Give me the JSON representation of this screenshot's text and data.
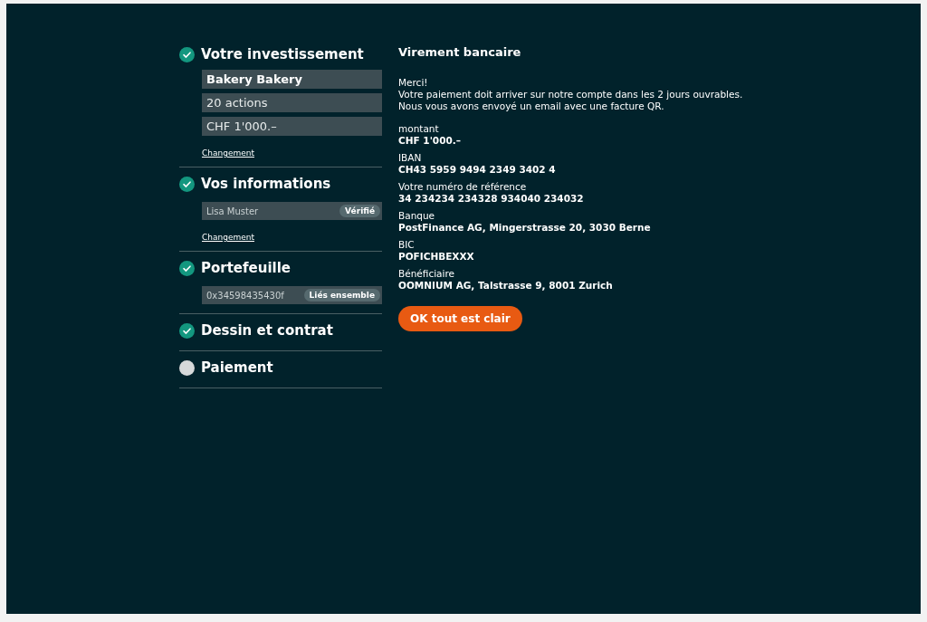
{
  "steps": [
    {
      "title": "Votre investissement",
      "completed": true,
      "fields": [
        {
          "kind": "heading",
          "value": "Bakery Bakery"
        },
        {
          "kind": "plain",
          "value": "20 actions"
        },
        {
          "kind": "plain",
          "value": "CHF 1'000.–"
        }
      ],
      "link": "Changement"
    },
    {
      "title": "Vos informations",
      "completed": true,
      "fields": [
        {
          "kind": "compact",
          "value": "Lisa Muster",
          "badge": "Vérifié"
        }
      ],
      "link": "Changement"
    },
    {
      "title": "Portefeuille",
      "completed": true,
      "fields": [
        {
          "kind": "compact",
          "value": "0x34598435430f",
          "badge": "Liés ensemble"
        }
      ]
    },
    {
      "title": "Dessin et contrat",
      "completed": true
    },
    {
      "title": "Paiement",
      "completed": false
    }
  ],
  "transfer": {
    "title": "Virement bancaire",
    "intro": "Merci!",
    "message": "Votre paiement doit arriver sur notre compte dans les 2 jours ouvrables. Nous vous avons envoyé un email avec une facture QR.",
    "details": [
      {
        "label": "montant",
        "value": "CHF 1'000.–"
      },
      {
        "label": "IBAN",
        "value": "CH43 5959 9494 2349 3402 4"
      },
      {
        "label": "Votre numéro de référence",
        "value": "34 234234 234328 934040 234032"
      },
      {
        "label": "Banque",
        "value": "PostFinance AG, Mingerstrasse 20, 3030 Berne"
      },
      {
        "label": "BIC",
        "value": "POFICHBEXXX"
      },
      {
        "label": "Bénéficiaire",
        "value": "OOMNIUM AG, Talstrasse 9, 8001 Zurich"
      }
    ],
    "button": "OK tout est clair"
  }
}
